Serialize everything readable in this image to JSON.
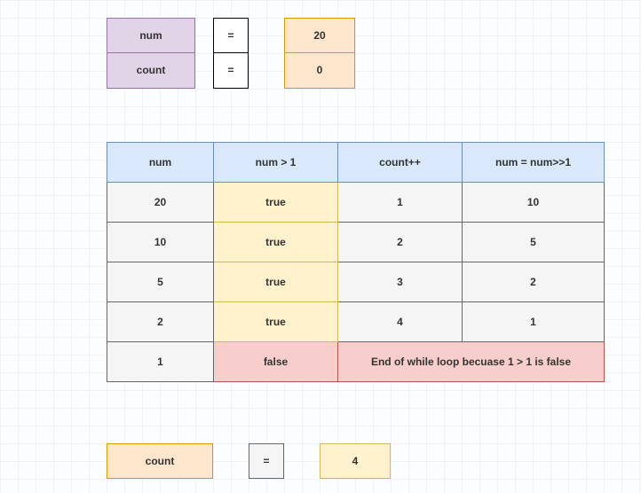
{
  "init": {
    "var1": "num",
    "eq": "=",
    "val1": "20",
    "var2": "count",
    "val2": "0"
  },
  "trace": {
    "headers": [
      "num",
      "num > 1",
      "count++",
      "num = num>>1"
    ],
    "rows": [
      {
        "num": "20",
        "cond": "true",
        "count": "1",
        "next": "10"
      },
      {
        "num": "10",
        "cond": "true",
        "count": "2",
        "next": "5"
      },
      {
        "num": "5",
        "cond": "true",
        "count": "3",
        "next": "2"
      },
      {
        "num": "2",
        "cond": "true",
        "count": "4",
        "next": "1"
      }
    ],
    "final": {
      "num": "1",
      "cond": "false",
      "msg": "End of while loop becuase 1 > 1 is false"
    }
  },
  "result": {
    "label": "count",
    "eq": "=",
    "value": "4"
  }
}
